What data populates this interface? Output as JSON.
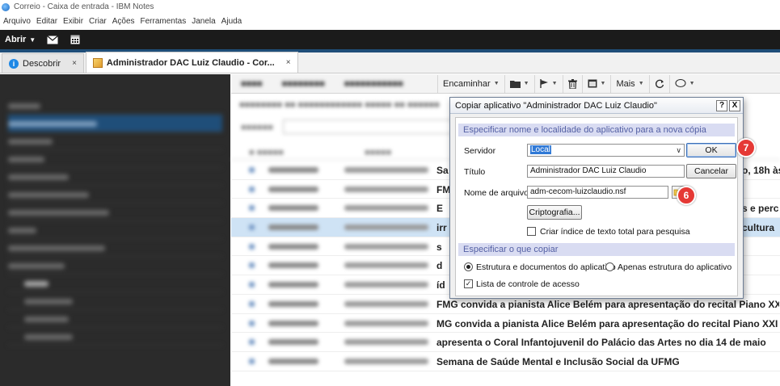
{
  "window": {
    "title": "Correio - Caixa de entrada - IBM Notes"
  },
  "menu": [
    "Arquivo",
    "Editar",
    "Exibir",
    "Criar",
    "Ações",
    "Ferramentas",
    "Janela",
    "Ajuda"
  ],
  "toolbar": {
    "open_label": "Abrir"
  },
  "tabs": [
    {
      "label": "Descobrir"
    },
    {
      "label": "Administrador DAC Luiz Claudio - Cor..."
    }
  ],
  "actionbar": {
    "forward_label": "Encaminhar",
    "more_label": "Mais"
  },
  "messages": [
    {
      "subject": "Sa",
      "tail": "o, 18h às"
    },
    {
      "subject": "FM",
      "tail": ""
    },
    {
      "subject": "E",
      "tail": "s e perc"
    },
    {
      "subject": "irr",
      "tail": "cultura"
    },
    {
      "subject": "s",
      "tail": ""
    },
    {
      "subject": "d",
      "tail": ""
    },
    {
      "subject": "íd",
      "tail": ""
    },
    {
      "subject": "FMG convida a pianista Alice Belém para apresentação do recital Piano XXI n",
      "tail": ""
    },
    {
      "subject": "MG convida a pianista Alice Belém para apresentação do recital Piano XXI n",
      "tail": ""
    },
    {
      "subject": "apresenta o Coral Infantojuvenil do Palácio das Artes no dia 14 de maio",
      "tail": ""
    },
    {
      "subject": "Semana de Saúde Mental e Inclusão Social da UFMG",
      "tail": ""
    }
  ],
  "dialog": {
    "title": "Copiar aplicativo \"Administrador DAC Luiz Claudio\"",
    "help_label": "?",
    "close_label": "X",
    "section1": "Especificar nome e localidade do aplicativo para a nova cópia",
    "server_label": "Servidor",
    "server_value": "Local",
    "title_label": "Título",
    "title_value": "Administrador DAC Luiz Claudio",
    "filename_label": "Nome de arquivo",
    "filename_value": "adm-cecom-luizclaudio.nsf",
    "encryption_button": "Criptografia...",
    "fulltext_label": "Criar índice de texto total para pesquisa",
    "fulltext_checked": false,
    "section2": "Especificar o que copiar",
    "option_full": "Estrutura e documentos do aplicativo",
    "option_design": "Apenas estrutura do aplicativo",
    "acl_label": "Lista de controle de acesso",
    "acl_checked": true,
    "ok_label": "OK",
    "cancel_label": "Cancelar"
  },
  "annotations": {
    "ok_marker": "7",
    "folder_marker": "6"
  },
  "colors": {
    "accent": "#1f4e79",
    "marker": "#e53935",
    "section_bg": "#d9dcf2",
    "section_text": "#5460a4"
  }
}
